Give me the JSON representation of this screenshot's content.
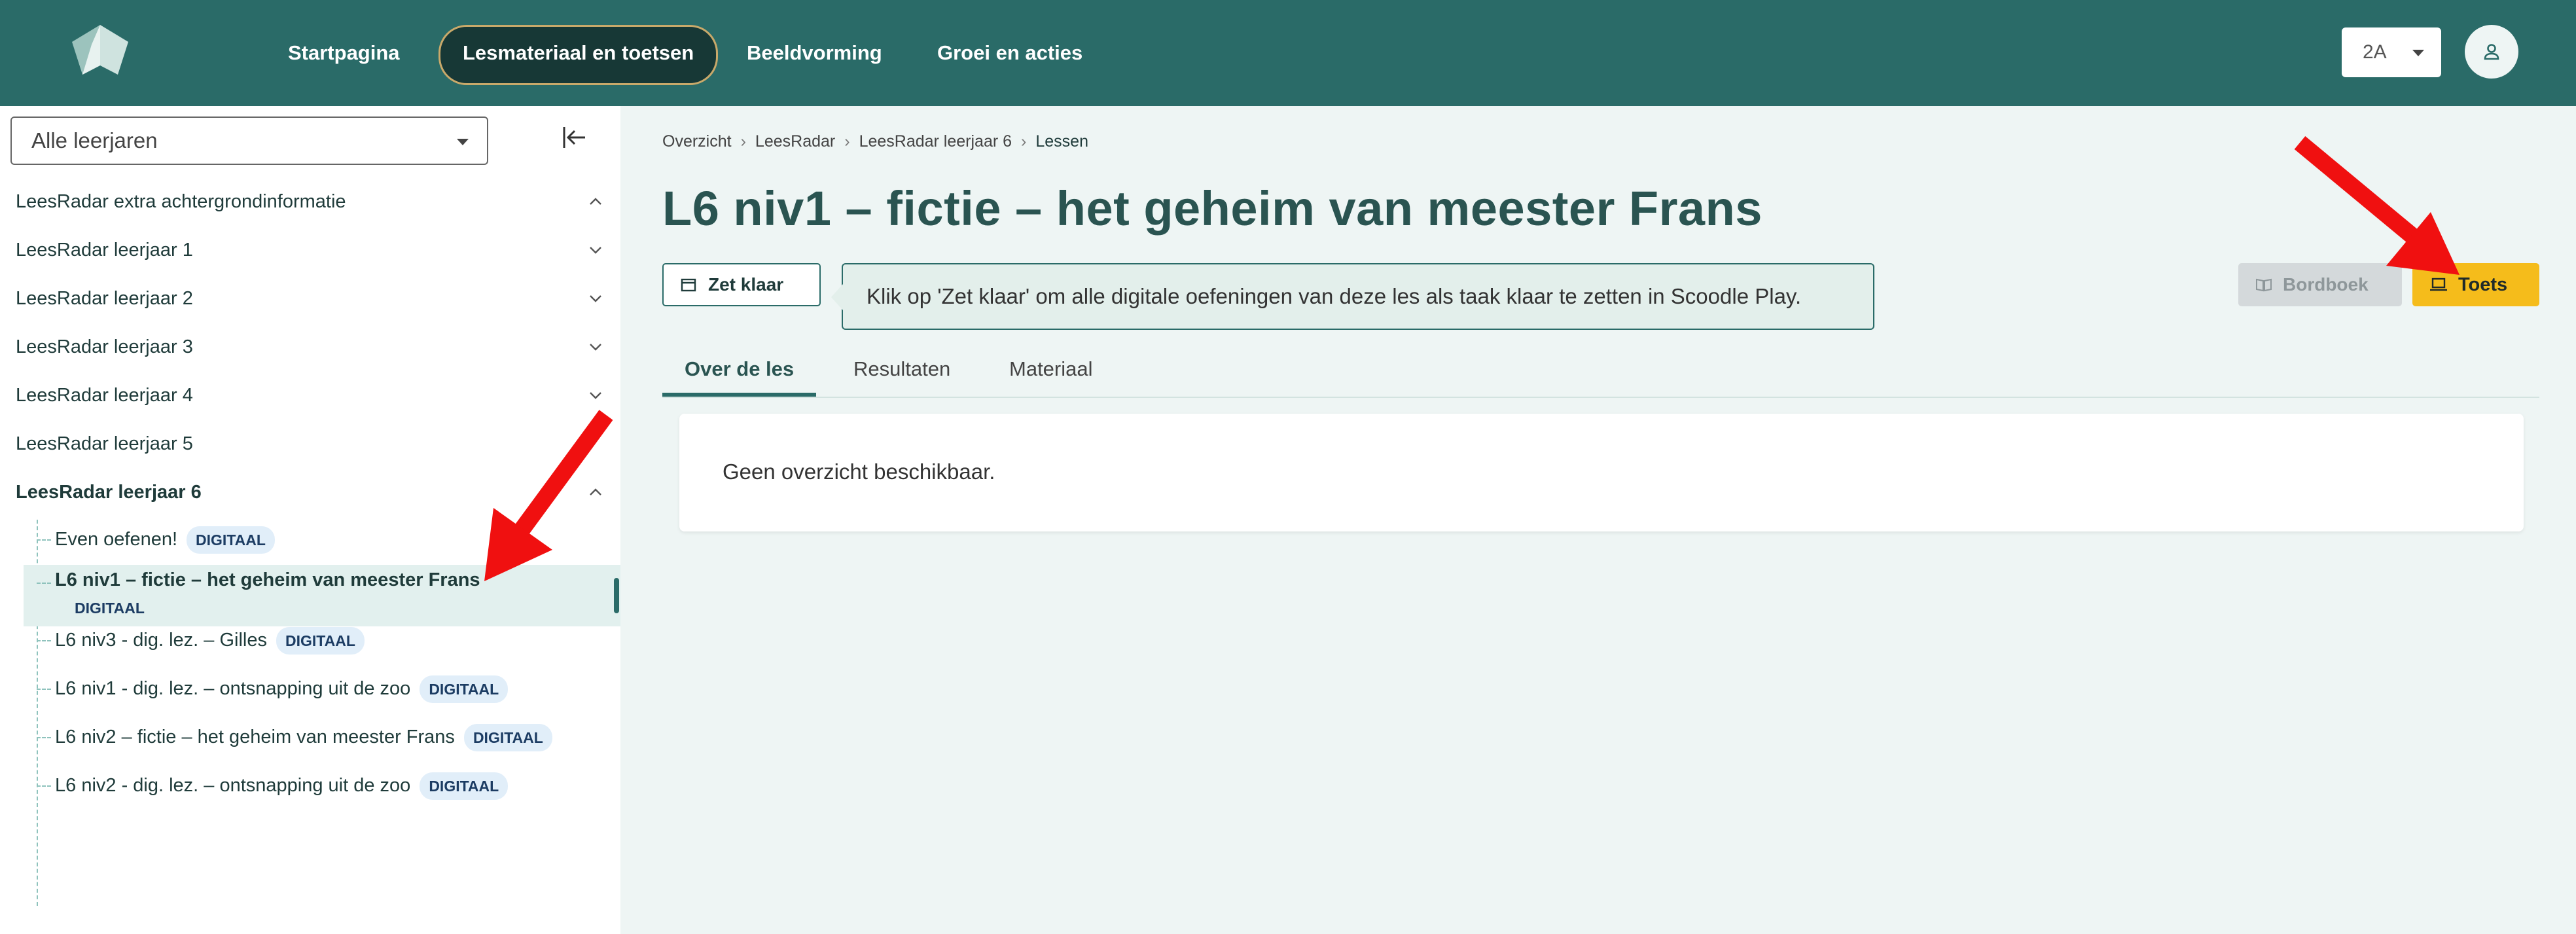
{
  "nav": {
    "items": [
      "Startpagina",
      "Lesmateriaal en toetsen",
      "Beeldvorming",
      "Groei en acties"
    ],
    "active_index": 1,
    "class_select": "2A",
    "logo_icon": "origami-logo-icon",
    "user_icon": "user-icon"
  },
  "sidebar": {
    "year_select": "Alle leerjaren",
    "groups": [
      {
        "label": "LeesRadar extra achtergrondinformatie",
        "expanded": true
      },
      {
        "label": "LeesRadar leerjaar 1",
        "expanded": false
      },
      {
        "label": "LeesRadar leerjaar 2",
        "expanded": false
      },
      {
        "label": "LeesRadar leerjaar 3",
        "expanded": false
      },
      {
        "label": "LeesRadar leerjaar 4",
        "expanded": false
      },
      {
        "label": "LeesRadar leerjaar 5",
        "expanded": false
      },
      {
        "label": "LeesRadar leerjaar 6",
        "expanded": true
      }
    ],
    "lessons": [
      {
        "title": "Even oefenen!",
        "badge": "DIGITAAL"
      },
      {
        "title": "L6 niv1 – fictie – het geheim van meester Frans",
        "badge": "DIGITAAL",
        "active": true
      },
      {
        "title": "L6 niv3 - dig. lez. – Gilles",
        "badge": "DIGITAAL"
      },
      {
        "title": "L6 niv1 - dig. lez. – ontsnapping uit de zoo",
        "badge": "DIGITAAL"
      },
      {
        "title": "L6 niv2 – fictie – het geheim van meester Frans",
        "badge": "DIGITAAL"
      },
      {
        "title": "L6 niv2 - dig. lez. – ontsnapping uit de zoo",
        "badge": "DIGITAAL"
      }
    ]
  },
  "main": {
    "breadcrumb": [
      "Overzicht",
      "LeesRadar",
      "LeesRadar leerjaar 6",
      "Lessen"
    ],
    "title": "L6 niv1 – fictie – het geheim van meester Frans",
    "zet_klaar": "Zet klaar",
    "hint": "Klik op 'Zet klaar' om alle digitale oefeningen van deze les als taak klaar te zetten in Scoodle Play.",
    "bordboek": "Bordboek",
    "toets": "Toets",
    "tabs": [
      "Over de les",
      "Resultaten",
      "Materiaal"
    ],
    "active_tab": 0,
    "overview_text": "Geen overzicht beschikbaar."
  },
  "colors": {
    "header": "#2a6b68",
    "active_nav": "#173836",
    "toets": "#f5bc1b",
    "badge_bg": "#e1eef9",
    "annotation_arrow": "#f01010"
  }
}
